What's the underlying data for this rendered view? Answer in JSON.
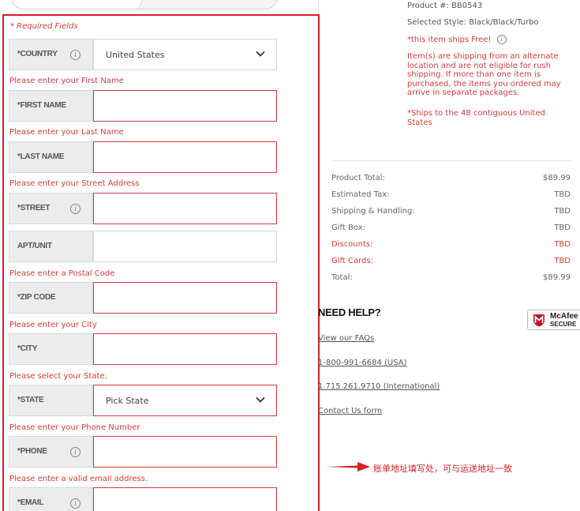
{
  "form": {
    "required_note": "* Required Fields",
    "country": {
      "label": "*COUNTRY",
      "value": "United States"
    },
    "first_name": {
      "error": "Please enter your First Name",
      "label": "*FIRST NAME",
      "value": ""
    },
    "last_name": {
      "error": "Please enter your Last Name",
      "label": "*LAST NAME",
      "value": ""
    },
    "street": {
      "error": "Please enter your Street Address",
      "label": "*STREET",
      "value": ""
    },
    "apt": {
      "label": "APT/UNIT",
      "value": ""
    },
    "zip": {
      "error": "Please enter a Postal Code",
      "label": "*ZIP CODE",
      "value": ""
    },
    "city": {
      "error": "Please enter your City",
      "label": "*CITY",
      "value": ""
    },
    "state": {
      "error": "Please select your State.",
      "label": "*STATE",
      "value": "Pick State"
    },
    "phone": {
      "error": "Please enter your Phone Number",
      "label": "*PHONE",
      "value": ""
    },
    "email": {
      "error": "Please enter a valid email address.",
      "label": "*EMAIL",
      "value": ""
    }
  },
  "product": {
    "number": "Product #: BB0543",
    "style": "Selected Style: Black/Black/Turbo",
    "ships_free": "*this item ships Free!",
    "shipping_note_lines": [
      "Item(s) are shipping from an alternate",
      "location and are not eligible for rush",
      "shipping. If more than one item is",
      "purchased, the items you ordered may",
      "arrive in separate packages."
    ],
    "contiguous_lines": [
      "*Ships to the 48 contiguous United",
      "States"
    ]
  },
  "summary": {
    "rows": [
      {
        "label": "Product Total:",
        "value": "$89.99",
        "red": false
      },
      {
        "label": "Estimated Tax:",
        "value": "TBD",
        "red": false
      },
      {
        "label": "Shipping & Handling:",
        "value": "TBD",
        "red": false
      },
      {
        "label": "Gift Box:",
        "value": "TBD",
        "red": false
      },
      {
        "label": "Discounts:",
        "value": "TBD",
        "red": true
      },
      {
        "label": "Gift Cards:",
        "value": "TBD",
        "red": true
      },
      {
        "label": "Total:",
        "value": "$89.99",
        "red": false
      }
    ]
  },
  "help": {
    "title": "NEED HELP?",
    "faq": "View our FAQs",
    "phone_usa": "1-800-991-6684 (USA)",
    "phone_intl": "1.715.261.9710 (International)",
    "contact": "Contact Us form"
  },
  "badge": {
    "line1": "McAfee",
    "line2": "SECURE"
  },
  "annotation": "账单地址填写处，可与运送地址一致",
  "colors": {
    "error": "#d23c3c",
    "highlight": "#d81f26"
  }
}
